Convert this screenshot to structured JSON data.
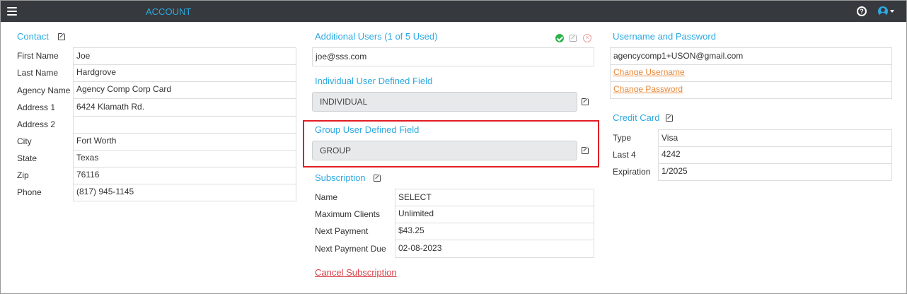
{
  "header": {
    "title": "ACCOUNT"
  },
  "contact": {
    "title": "Contact",
    "fields": [
      {
        "label": "First Name",
        "value": "Joe"
      },
      {
        "label": "Last Name",
        "value": "Hardgrove"
      },
      {
        "label": "Agency Name",
        "value": "Agency Comp Corp Card"
      },
      {
        "label": "Address 1",
        "value": "6424 Klamath Rd."
      },
      {
        "label": "Address 2",
        "value": ""
      },
      {
        "label": "City",
        "value": "Fort Worth"
      },
      {
        "label": "State",
        "value": "Texas"
      },
      {
        "label": "Zip",
        "value": "76116"
      },
      {
        "label": "Phone",
        "value": "(817) 945-1145"
      }
    ]
  },
  "additional_users": {
    "title": "Additional Users (1 of 5 Used)",
    "users": [
      "joe@sss.com"
    ]
  },
  "individual_udf": {
    "title": "Individual User Defined Field",
    "value": "INDIVIDUAL"
  },
  "group_udf": {
    "title": "Group User Defined Field",
    "value": "GROUP"
  },
  "subscription": {
    "title": "Subscription",
    "fields": [
      {
        "label": "Name",
        "value": "SELECT"
      },
      {
        "label": "Maximum Clients",
        "value": "Unlimited"
      },
      {
        "label": "Next Payment",
        "value": "$43.25"
      },
      {
        "label": "Next Payment Due",
        "value": "02-08-2023"
      }
    ],
    "cancel_label": "Cancel Subscription"
  },
  "credentials": {
    "title": "Username and Password",
    "username": "agencycomp1+USON@gmail.com",
    "change_username_label": "Change Username",
    "change_password_label": "Change Password"
  },
  "credit_card": {
    "title": "Credit Card",
    "fields": [
      {
        "label": "Type",
        "value": "Visa"
      },
      {
        "label": "Last 4",
        "value": "4242"
      },
      {
        "label": "Expiration",
        "value": "1/2025"
      }
    ]
  },
  "colors": {
    "header_bg": "#363a3e",
    "accent": "#2ca9e1",
    "link_orange": "#e8893a",
    "cancel_red": "#d9434b",
    "highlight_red": "#e11d23",
    "success_green": "#2db34a"
  }
}
